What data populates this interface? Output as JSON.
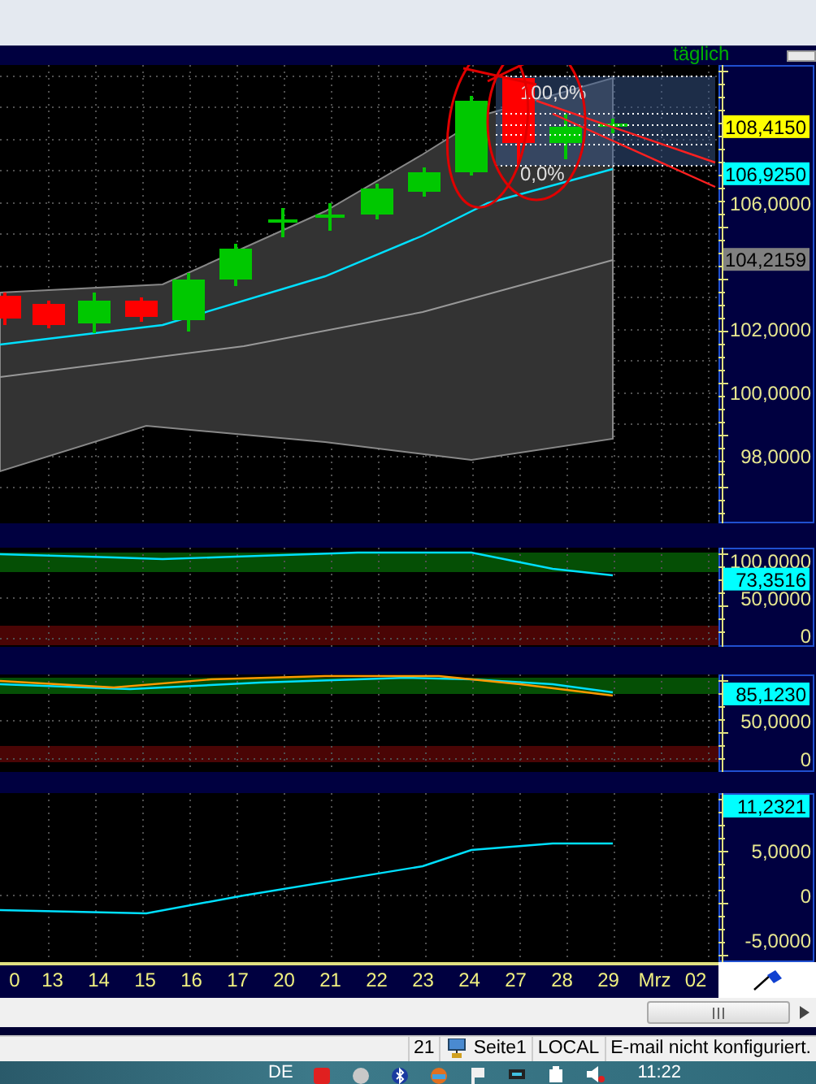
{
  "header": {
    "period": "täglich"
  },
  "price_panel": {
    "fib_labels": [
      "100,0%",
      "0,0%"
    ],
    "axis": [
      {
        "label": "108,4150",
        "kind": "badge",
        "color": "#ffff00"
      },
      {
        "label": "106,9250",
        "kind": "badge",
        "color": "#00ffff"
      },
      {
        "label": "106,0000",
        "kind": "tick"
      },
      {
        "label": "104,2159",
        "kind": "badge",
        "color": "#808080"
      },
      {
        "label": "102,0000",
        "kind": "tick"
      },
      {
        "label": "100,0000",
        "kind": "tick"
      },
      {
        "label": "98,0000",
        "kind": "tick"
      }
    ]
  },
  "oscillator_1": {
    "axis": [
      {
        "label": "100,0000",
        "kind": "tick"
      },
      {
        "label": "73,3516",
        "kind": "badge",
        "color": "#00ffff"
      },
      {
        "label": "50,0000",
        "kind": "tick"
      },
      {
        "label": "0",
        "kind": "tick"
      }
    ]
  },
  "oscillator_2": {
    "axis": [
      {
        "label": "85,1230",
        "kind": "badge",
        "color": "#00ffff"
      },
      {
        "label": "50,0000",
        "kind": "tick"
      },
      {
        "label": "0",
        "kind": "tick"
      }
    ]
  },
  "oscillator_3": {
    "axis": [
      {
        "label": "11,2321",
        "kind": "badge",
        "color": "#00ffff"
      },
      {
        "label": "5,0000",
        "kind": "tick"
      },
      {
        "label": "0",
        "kind": "tick"
      },
      {
        "label": "-5,0000",
        "kind": "tick"
      }
    ]
  },
  "date_axis": [
    "0",
    "13",
    "14",
    "15",
    "16",
    "17",
    "20",
    "21",
    "22",
    "23",
    "24",
    "27",
    "28",
    "29",
    "Mrz",
    "02"
  ],
  "status_bar": {
    "page_number": "21",
    "page": "Seite1",
    "connection": "LOCAL",
    "message": "E-mail nicht konfiguriert."
  },
  "taskbar": {
    "language": "DE",
    "clock": "11:22"
  }
}
